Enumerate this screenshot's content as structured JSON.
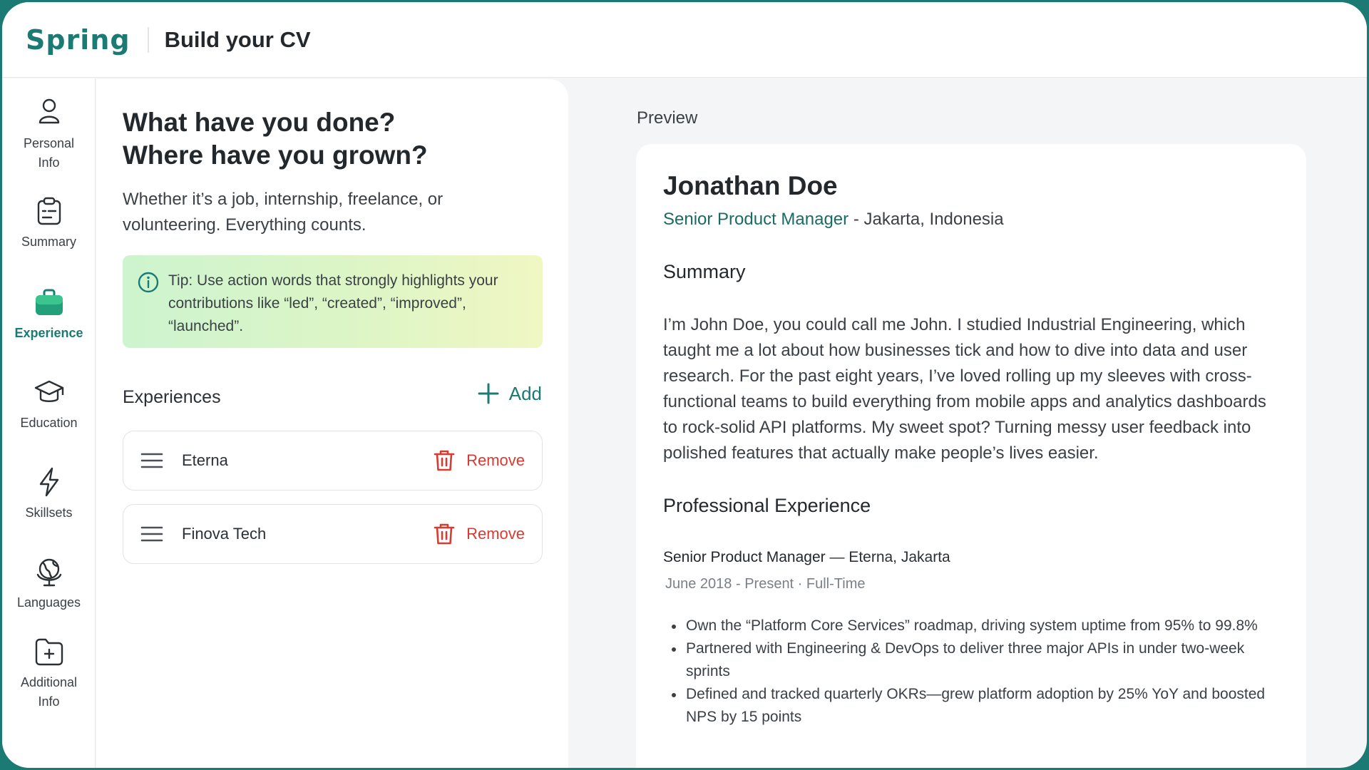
{
  "header": {
    "logo": "Spring",
    "title": "Build your CV"
  },
  "nav": {
    "items": [
      {
        "label": "Personal\nInfo",
        "icon": "user-icon"
      },
      {
        "label": "Summary",
        "icon": "clipboard-icon"
      },
      {
        "label": "Experience",
        "icon": "briefcase-icon",
        "active": true
      },
      {
        "label": "Education",
        "icon": "graduation-cap-icon"
      },
      {
        "label": "Skillsets",
        "icon": "lightning-icon"
      },
      {
        "label": "Languages",
        "icon": "globe-icon"
      },
      {
        "label": "Additional\nInfo",
        "icon": "folder-plus-icon"
      }
    ]
  },
  "form": {
    "title": "What have you done?\nWhere have you grown?",
    "subtitle": "Whether it’s a job, internship, freelance, or volunteering. Everything counts.",
    "tip": "Tip: Use action words that strongly highlights your contributions like “led”, “created”, “improved”, “launched”.",
    "experiences_label": "Experiences",
    "add_label": "Add",
    "remove_label": "Remove",
    "experiences": [
      {
        "name": "Eterna"
      },
      {
        "name": "Finova Tech"
      }
    ]
  },
  "preview": {
    "label": "Preview",
    "name": "Jonathan Doe",
    "role": "Senior Product Manager",
    "location": " - Jakarta, Indonesia",
    "summary_heading": "Summary",
    "summary": "I’m John Doe, you could call me John. I studied Industrial Engineering, which taught me a lot about how businesses tick and how to dive into data and user research. For the past eight years, I’ve loved rolling up my sleeves with cross-functional teams to build everything from mobile apps and analytics dashboards to rock-solid API platforms. My sweet spot? Turning messy user feedback into polished features that actually make people’s lives easier.",
    "experience_heading": "Professional Experience",
    "job_title": "Senior Product Manager",
    "job_company": " — Eterna, Jakarta",
    "job_dates": "June 2018 - Present · Full-Time",
    "bullets": [
      "Own the “Platform Core Services” roadmap, driving system uptime from 95% to 99.8%",
      "Partnered with Engineering & DevOps to deliver three major APIs in under two-week sprints",
      "Defined and tracked quarterly OKRs—grew platform adoption by 25% YoY and boosted NPS by 15 points"
    ]
  },
  "colors": {
    "brand": "#1b7a73",
    "danger": "#d93a31",
    "tip_gradient_start": "#cdf4cf",
    "tip_gradient_end": "#f0f7c3"
  }
}
